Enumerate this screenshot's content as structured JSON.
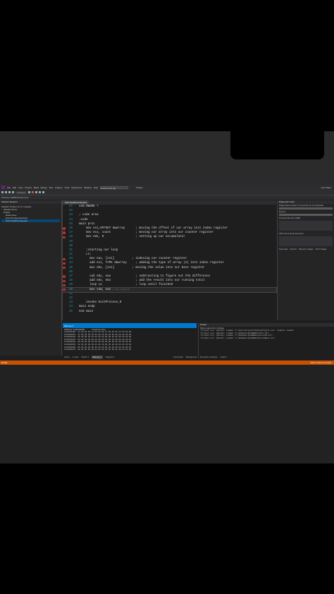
{
  "window": {
    "title": "Project",
    "search_placeholder": "Search (Ctrl+Q)",
    "live_share": "Live Share"
  },
  "menu": [
    "File",
    "Edit",
    "View",
    "Project",
    "Build",
    "Debug",
    "Test",
    "Analyze",
    "Tools",
    "Extensions",
    "Window",
    "Help"
  ],
  "toolbar": {
    "continue_label": "Continue",
    "process_label": "Process: [10256] Project.exe"
  },
  "solution_explorer": {
    "title": "Solution Explorer",
    "items": [
      "Solution 'Project' (1 of 1 project)",
      "Solution Items",
      "Project",
      "References",
      "External Dependencies",
      "SummingTheArray.asm"
    ]
  },
  "editor": {
    "tab": "SummingTheArray.asm",
    "hint": "≤ 1ms elapsed",
    "lines": [
      {
        "num": "21",
        "text": "  sum DWORD ?",
        "bp": false
      },
      {
        "num": "22",
        "text": "",
        "bp": false
      },
      {
        "num": "23",
        "text": "  ; code area",
        "bp": false
      },
      {
        "num": "24",
        "text": "  .code",
        "bp": false
      },
      {
        "num": "25",
        "text": "  main proc",
        "bp": false
      },
      {
        "num": "26",
        "text": "      mov esi,OFFSET dwarray      ; moving the offset of our array into index register",
        "bp": true
      },
      {
        "num": "27",
        "text": "      mov ecx, count              ; moving our array into our counter register",
        "bp": true
      },
      {
        "num": "28",
        "text": "      mov edx, 0                  ; setting up our accumulator",
        "bp": true
      },
      {
        "num": "29",
        "text": "",
        "bp": false
      },
      {
        "num": "30",
        "text": "",
        "bp": false
      },
      {
        "num": "31",
        "text": "      ;starting our loop",
        "bp": false
      },
      {
        "num": "32",
        "text": "      L1:",
        "bp": false
      },
      {
        "num": "33",
        "text": "        mov eax, [esi]          ; indexing our counter register",
        "bp": true
      },
      {
        "num": "34",
        "text": "        add esi, TYPE dwarray     ; adding the type of array (4) into index register",
        "bp": true
      },
      {
        "num": "35",
        "text": "        mov ebx, [esi]          ; moving the value into our base register",
        "bp": true
      },
      {
        "num": "36",
        "text": "",
        "bp": false
      },
      {
        "num": "37",
        "text": "        sub ebx, eax              ; subtracting to figure out the difference",
        "bp": true
      },
      {
        "num": "38",
        "text": "        add edx, ebx              ; add the result into our running total",
        "bp": true
      },
      {
        "num": "39",
        "text": "        loop L1                   ; loop until finished",
        "bp": true
      },
      {
        "num": "40",
        "text": "        mov sum, edx",
        "bp": true,
        "current": true
      },
      {
        "num": "41",
        "text": "",
        "bp": false
      },
      {
        "num": "42",
        "text": "",
        "bp": false
      },
      {
        "num": "43",
        "text": "      invoke ExitProcess,0",
        "bp": false
      },
      {
        "num": "44",
        "text": "  main endp",
        "bp": false
      },
      {
        "num": "45",
        "text": "  end main",
        "bp": false
      }
    ]
  },
  "diagnostics": {
    "title": "Diagnostic Tools",
    "session": "Diagnostics session: 6 seconds (1 ms selected)",
    "events": "Events",
    "process_memory": "Process Memory (MB)",
    "cpu": "CPU (% of all processors)",
    "summary": "Summary",
    "tabs": [
      "Summary",
      "Events",
      "Memory Usage",
      "CPU Usage"
    ]
  },
  "memory": {
    "title": "Memory 1",
    "address_label": "Address: 0x00404000",
    "columns_label": "Columns: Auto",
    "rows": [
      "0x00404000  0a 00 00 00 14 00 00 00 1e 00 00 00 28 00 00 00",
      "0x00404010  32 00 00 00 05 00 00 00 00 00 00 00 00 00 00 00",
      "0x00404020  00 00 00 00 00 00 00 00 00 00 00 00 00 00 00 00",
      "0x00404030  00 00 00 00 00 00 00 00 00 00 00 00 00 00 00 00",
      "0x00404040  00 00 00 00 00 00 00 00 00 00 00 00 00 00 00 00",
      "0x00404050  00 00 00 00 00 00 00 00 00 00 00 00 00 00 00 00",
      "0x00404060  00 00 00 00 00 00 00 00 00 00 00 00 00 00 00 00",
      "0x00404070  00 00 00 00 00 00 00 00 00 00 00 00 00 00 00 00"
    ]
  },
  "output": {
    "title": "Output",
    "source_label": "Show output from: Debug",
    "rows": [
      "'Project.exe' (Win32): Loaded 'C:\\Users\\Project\\Debug\\Project.exe'. Symbols loaded.",
      "'Project.exe' (Win32): Loaded 'C:\\Windows\\SysWOW64\\ntdll.dll'.",
      "'Project.exe' (Win32): Loaded 'C:\\Windows\\SysWOW64\\kernel32.dll'.",
      "'Project.exe' (Win32): Loaded 'C:\\Windows\\SysWOW64\\KernelBase.dll'."
    ]
  },
  "bottom_tabs": [
    "Autos",
    "Locals",
    "Watch 1",
    "Memory 1",
    "Registers",
    "Call Stack",
    "Breakpoints",
    "Exception Settings",
    "Output"
  ],
  "status": {
    "text": "Ready",
    "right": "Add to Source Control"
  }
}
